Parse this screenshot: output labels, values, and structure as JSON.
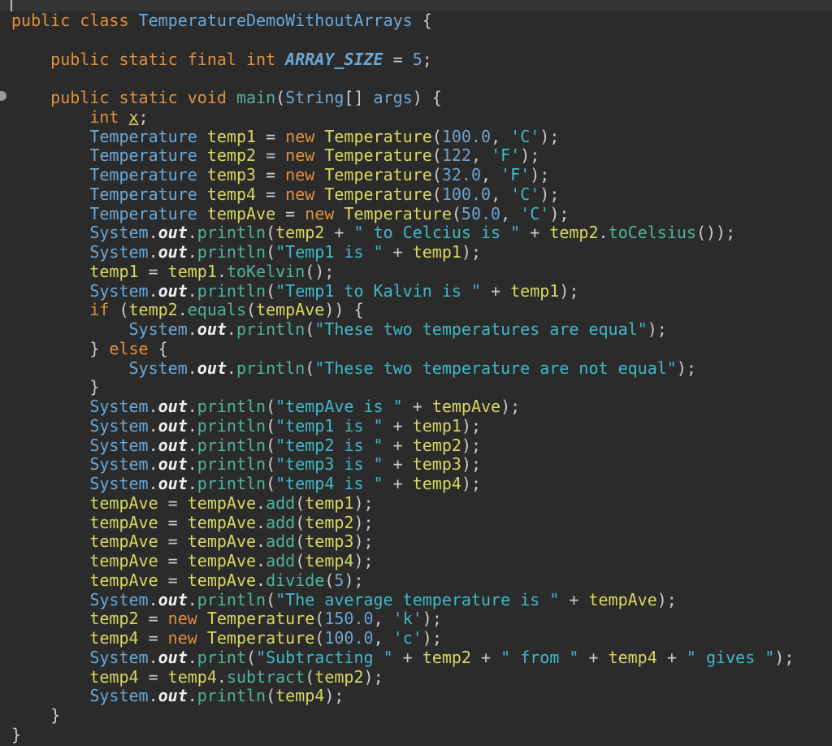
{
  "editor": {
    "lines": [
      [
        [
          "kw",
          "public class "
        ],
        [
          "cls",
          "TemperatureDemoWithoutArrays"
        ],
        [
          "punc",
          " {"
        ]
      ],
      [],
      [
        [
          "kw",
          "    public static final int "
        ],
        [
          "const",
          "ARRAY_SIZE"
        ],
        [
          "punc",
          " = "
        ],
        [
          "num",
          "5"
        ],
        [
          "punc",
          ";"
        ]
      ],
      [],
      [
        [
          "kw",
          "    public static void "
        ],
        [
          "meth",
          "main"
        ],
        [
          "punc",
          "("
        ],
        [
          "type",
          "String"
        ],
        [
          "punc",
          "[] "
        ],
        [
          "type",
          "args"
        ],
        [
          "punc",
          ") {"
        ]
      ],
      [
        [
          "kw",
          "        int "
        ],
        [
          "unused",
          "x"
        ],
        [
          "punc",
          ";"
        ]
      ],
      [
        [
          "type",
          "        Temperature "
        ],
        [
          "var",
          "temp1"
        ],
        [
          "punc",
          " = "
        ],
        [
          "kw",
          "new "
        ],
        [
          "fn",
          "Temperature"
        ],
        [
          "punc",
          "("
        ],
        [
          "num",
          "100.0"
        ],
        [
          "punc",
          ", "
        ],
        [
          "str",
          "'C'"
        ],
        [
          "punc",
          ");"
        ]
      ],
      [
        [
          "type",
          "        Temperature "
        ],
        [
          "var",
          "temp2"
        ],
        [
          "punc",
          " = "
        ],
        [
          "kw",
          "new "
        ],
        [
          "fn",
          "Temperature"
        ],
        [
          "punc",
          "("
        ],
        [
          "num",
          "122"
        ],
        [
          "punc",
          ", "
        ],
        [
          "str",
          "'F'"
        ],
        [
          "punc",
          ");"
        ]
      ],
      [
        [
          "type",
          "        Temperature "
        ],
        [
          "var",
          "temp3"
        ],
        [
          "punc",
          " = "
        ],
        [
          "kw",
          "new "
        ],
        [
          "fn",
          "Temperature"
        ],
        [
          "punc",
          "("
        ],
        [
          "num",
          "32.0"
        ],
        [
          "punc",
          ", "
        ],
        [
          "str",
          "'F'"
        ],
        [
          "punc",
          ");"
        ]
      ],
      [
        [
          "type",
          "        Temperature "
        ],
        [
          "var",
          "temp4"
        ],
        [
          "punc",
          " = "
        ],
        [
          "kw",
          "new "
        ],
        [
          "fn",
          "Temperature"
        ],
        [
          "punc",
          "("
        ],
        [
          "num",
          "100.0"
        ],
        [
          "punc",
          ", "
        ],
        [
          "str",
          "'C'"
        ],
        [
          "punc",
          ");"
        ]
      ],
      [
        [
          "type",
          "        Temperature "
        ],
        [
          "var",
          "tempAve"
        ],
        [
          "punc",
          " = "
        ],
        [
          "kw",
          "new "
        ],
        [
          "fn",
          "Temperature"
        ],
        [
          "punc",
          "("
        ],
        [
          "num",
          "50.0"
        ],
        [
          "punc",
          ", "
        ],
        [
          "str",
          "'C'"
        ],
        [
          "punc",
          ");"
        ]
      ],
      [
        [
          "type",
          "        System"
        ],
        [
          "punc",
          "."
        ],
        [
          "field",
          "out"
        ],
        [
          "punc",
          "."
        ],
        [
          "meth",
          "println"
        ],
        [
          "punc",
          "("
        ],
        [
          "var",
          "temp2"
        ],
        [
          "punc",
          " + "
        ],
        [
          "str",
          "\" to Celcius is \""
        ],
        [
          "punc",
          " + "
        ],
        [
          "var",
          "temp2"
        ],
        [
          "punc",
          "."
        ],
        [
          "meth",
          "toCelsius"
        ],
        [
          "punc",
          "());"
        ]
      ],
      [
        [
          "type",
          "        System"
        ],
        [
          "punc",
          "."
        ],
        [
          "field",
          "out"
        ],
        [
          "punc",
          "."
        ],
        [
          "meth",
          "println"
        ],
        [
          "punc",
          "("
        ],
        [
          "str",
          "\"Temp1 is \""
        ],
        [
          "punc",
          " + "
        ],
        [
          "var",
          "temp1"
        ],
        [
          "punc",
          ");"
        ]
      ],
      [
        [
          "var",
          "        temp1"
        ],
        [
          "punc",
          " = "
        ],
        [
          "var",
          "temp1"
        ],
        [
          "punc",
          "."
        ],
        [
          "meth",
          "toKelvin"
        ],
        [
          "punc",
          "();"
        ]
      ],
      [
        [
          "type",
          "        System"
        ],
        [
          "punc",
          "."
        ],
        [
          "field",
          "out"
        ],
        [
          "punc",
          "."
        ],
        [
          "meth",
          "println"
        ],
        [
          "punc",
          "("
        ],
        [
          "str",
          "\"Temp1 to Kalvin is \""
        ],
        [
          "punc",
          " + "
        ],
        [
          "var",
          "temp1"
        ],
        [
          "punc",
          ");"
        ]
      ],
      [
        [
          "kw",
          "        if "
        ],
        [
          "punc",
          "("
        ],
        [
          "var",
          "temp2"
        ],
        [
          "punc",
          "."
        ],
        [
          "meth",
          "equals"
        ],
        [
          "punc",
          "("
        ],
        [
          "var",
          "tempAve"
        ],
        [
          "punc",
          ")) {"
        ]
      ],
      [
        [
          "type",
          "            System"
        ],
        [
          "punc",
          "."
        ],
        [
          "field",
          "out"
        ],
        [
          "punc",
          "."
        ],
        [
          "meth",
          "println"
        ],
        [
          "punc",
          "("
        ],
        [
          "str",
          "\"These two temperatures are equal\""
        ],
        [
          "punc",
          ");"
        ]
      ],
      [
        [
          "punc",
          "        } "
        ],
        [
          "kw",
          "else"
        ],
        [
          "punc",
          " {"
        ]
      ],
      [
        [
          "type",
          "            System"
        ],
        [
          "punc",
          "."
        ],
        [
          "field",
          "out"
        ],
        [
          "punc",
          "."
        ],
        [
          "meth",
          "println"
        ],
        [
          "punc",
          "("
        ],
        [
          "str",
          "\"These two temperature are not equal\""
        ],
        [
          "punc",
          ");"
        ]
      ],
      [
        [
          "punc",
          "        }"
        ]
      ],
      [
        [
          "type",
          "        System"
        ],
        [
          "punc",
          "."
        ],
        [
          "field",
          "out"
        ],
        [
          "punc",
          "."
        ],
        [
          "meth",
          "println"
        ],
        [
          "punc",
          "("
        ],
        [
          "str",
          "\"tempAve is \""
        ],
        [
          "punc",
          " + "
        ],
        [
          "var",
          "tempAve"
        ],
        [
          "punc",
          ");"
        ]
      ],
      [
        [
          "type",
          "        System"
        ],
        [
          "punc",
          "."
        ],
        [
          "field",
          "out"
        ],
        [
          "punc",
          "."
        ],
        [
          "meth",
          "println"
        ],
        [
          "punc",
          "("
        ],
        [
          "str",
          "\"temp1 is \""
        ],
        [
          "punc",
          " + "
        ],
        [
          "var",
          "temp1"
        ],
        [
          "punc",
          ");"
        ]
      ],
      [
        [
          "type",
          "        System"
        ],
        [
          "punc",
          "."
        ],
        [
          "field",
          "out"
        ],
        [
          "punc",
          "."
        ],
        [
          "meth",
          "println"
        ],
        [
          "punc",
          "("
        ],
        [
          "str",
          "\"temp2 is \""
        ],
        [
          "punc",
          " + "
        ],
        [
          "var",
          "temp2"
        ],
        [
          "punc",
          ");"
        ]
      ],
      [
        [
          "type",
          "        System"
        ],
        [
          "punc",
          "."
        ],
        [
          "field",
          "out"
        ],
        [
          "punc",
          "."
        ],
        [
          "meth",
          "println"
        ],
        [
          "punc",
          "("
        ],
        [
          "str",
          "\"temp3 is \""
        ],
        [
          "punc",
          " + "
        ],
        [
          "var",
          "temp3"
        ],
        [
          "punc",
          ");"
        ]
      ],
      [
        [
          "type",
          "        System"
        ],
        [
          "punc",
          "."
        ],
        [
          "field",
          "out"
        ],
        [
          "punc",
          "."
        ],
        [
          "meth",
          "println"
        ],
        [
          "punc",
          "("
        ],
        [
          "str",
          "\"temp4 is \""
        ],
        [
          "punc",
          " + "
        ],
        [
          "var",
          "temp4"
        ],
        [
          "punc",
          ");"
        ]
      ],
      [
        [
          "var",
          "        tempAve"
        ],
        [
          "punc",
          " = "
        ],
        [
          "var",
          "tempAve"
        ],
        [
          "punc",
          "."
        ],
        [
          "meth",
          "add"
        ],
        [
          "punc",
          "("
        ],
        [
          "var",
          "temp1"
        ],
        [
          "punc",
          ");"
        ]
      ],
      [
        [
          "var",
          "        tempAve"
        ],
        [
          "punc",
          " = "
        ],
        [
          "var",
          "tempAve"
        ],
        [
          "punc",
          "."
        ],
        [
          "meth",
          "add"
        ],
        [
          "punc",
          "("
        ],
        [
          "var",
          "temp2"
        ],
        [
          "punc",
          ");"
        ]
      ],
      [
        [
          "var",
          "        tempAve"
        ],
        [
          "punc",
          " = "
        ],
        [
          "var",
          "tempAve"
        ],
        [
          "punc",
          "."
        ],
        [
          "meth",
          "add"
        ],
        [
          "punc",
          "("
        ],
        [
          "var",
          "temp3"
        ],
        [
          "punc",
          ");"
        ]
      ],
      [
        [
          "var",
          "        tempAve"
        ],
        [
          "punc",
          " = "
        ],
        [
          "var",
          "tempAve"
        ],
        [
          "punc",
          "."
        ],
        [
          "meth",
          "add"
        ],
        [
          "punc",
          "("
        ],
        [
          "var",
          "temp4"
        ],
        [
          "punc",
          ");"
        ]
      ],
      [
        [
          "var",
          "        tempAve"
        ],
        [
          "punc",
          " = "
        ],
        [
          "var",
          "tempAve"
        ],
        [
          "punc",
          "."
        ],
        [
          "meth",
          "divide"
        ],
        [
          "punc",
          "("
        ],
        [
          "num",
          "5"
        ],
        [
          "punc",
          ");"
        ]
      ],
      [
        [
          "type",
          "        System"
        ],
        [
          "punc",
          "."
        ],
        [
          "field",
          "out"
        ],
        [
          "punc",
          "."
        ],
        [
          "meth",
          "println"
        ],
        [
          "punc",
          "("
        ],
        [
          "str",
          "\"The average temperature is \""
        ],
        [
          "punc",
          " + "
        ],
        [
          "var",
          "tempAve"
        ],
        [
          "punc",
          ");"
        ]
      ],
      [
        [
          "var",
          "        temp2"
        ],
        [
          "punc",
          " = "
        ],
        [
          "kw",
          "new "
        ],
        [
          "fn",
          "Temperature"
        ],
        [
          "punc",
          "("
        ],
        [
          "num",
          "150.0"
        ],
        [
          "punc",
          ", "
        ],
        [
          "str",
          "'k'"
        ],
        [
          "punc",
          ");"
        ]
      ],
      [
        [
          "var",
          "        temp4"
        ],
        [
          "punc",
          " = "
        ],
        [
          "kw",
          "new "
        ],
        [
          "fn",
          "Temperature"
        ],
        [
          "punc",
          "("
        ],
        [
          "num",
          "100.0"
        ],
        [
          "punc",
          ", "
        ],
        [
          "str",
          "'c'"
        ],
        [
          "punc",
          ");"
        ]
      ],
      [
        [
          "type",
          "        System"
        ],
        [
          "punc",
          "."
        ],
        [
          "field",
          "out"
        ],
        [
          "punc",
          "."
        ],
        [
          "meth",
          "print"
        ],
        [
          "punc",
          "("
        ],
        [
          "str",
          "\"Subtracting \""
        ],
        [
          "punc",
          " + "
        ],
        [
          "var",
          "temp2"
        ],
        [
          "punc",
          " + "
        ],
        [
          "str",
          "\" from \""
        ],
        [
          "punc",
          " + "
        ],
        [
          "var",
          "temp4"
        ],
        [
          "punc",
          " + "
        ],
        [
          "str",
          "\" gives \""
        ],
        [
          "punc",
          ");"
        ]
      ],
      [
        [
          "var",
          "        temp4"
        ],
        [
          "punc",
          " = "
        ],
        [
          "var",
          "temp4"
        ],
        [
          "punc",
          "."
        ],
        [
          "meth",
          "subtract"
        ],
        [
          "punc",
          "("
        ],
        [
          "var",
          "temp2"
        ],
        [
          "punc",
          ");"
        ]
      ],
      [
        [
          "type",
          "        System"
        ],
        [
          "punc",
          "."
        ],
        [
          "field",
          "out"
        ],
        [
          "punc",
          "."
        ],
        [
          "meth",
          "println"
        ],
        [
          "punc",
          "("
        ],
        [
          "var",
          "temp4"
        ],
        [
          "punc",
          ");"
        ]
      ],
      [
        [
          "punc",
          "    }"
        ]
      ],
      [
        [
          "punc",
          "}"
        ]
      ]
    ]
  }
}
